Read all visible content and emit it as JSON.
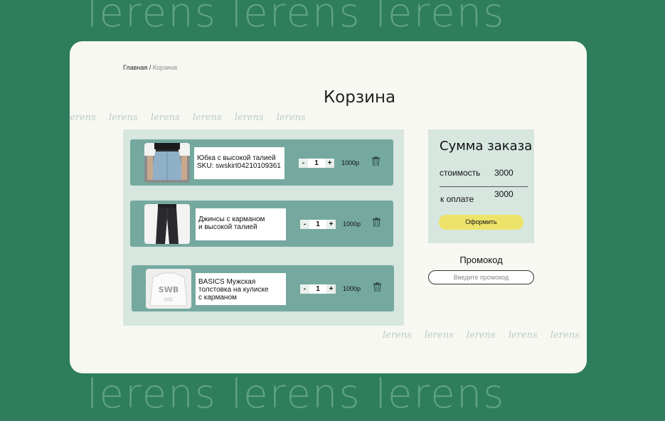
{
  "background": {
    "brand_word": "lerens lerens lerens",
    "color": "#2e7d5d"
  },
  "breadcrumb": {
    "home": "Главная",
    "separator": " / ",
    "current": "Корзина"
  },
  "page_title": "Корзина",
  "decor_script": [
    "lerens",
    "lerens",
    "lerens",
    "lerens",
    "lerens",
    "lerens"
  ],
  "cart": {
    "items": [
      {
        "name": "Юбка с высокой талией",
        "sku": "SKU: swskirt04210109361",
        "quantity": "1",
        "price": "1000р",
        "image": "denim-skirt-photo"
      },
      {
        "name": "Джинсы с карманом",
        "name2": "и высокой талией",
        "quantity": "1",
        "price": "1000р",
        "image": "jeans-photo"
      },
      {
        "name": "BASICS Мужская",
        "name2": "толстовка на кулиске",
        "name3": "с карманом",
        "quantity": "1",
        "price": "1000р",
        "image": "hoodie-photo"
      }
    ],
    "minus_label": "-",
    "plus_label": "+"
  },
  "summary": {
    "title": "Сумма заказа",
    "cost_label": "стоимость",
    "cost_value": "3000",
    "total_label": "к оплате",
    "total_value": "3000",
    "checkout_label": "Оформить",
    "accent": "#ede36a"
  },
  "promo": {
    "title": "Промокод",
    "placeholder": "Введите промокод"
  }
}
